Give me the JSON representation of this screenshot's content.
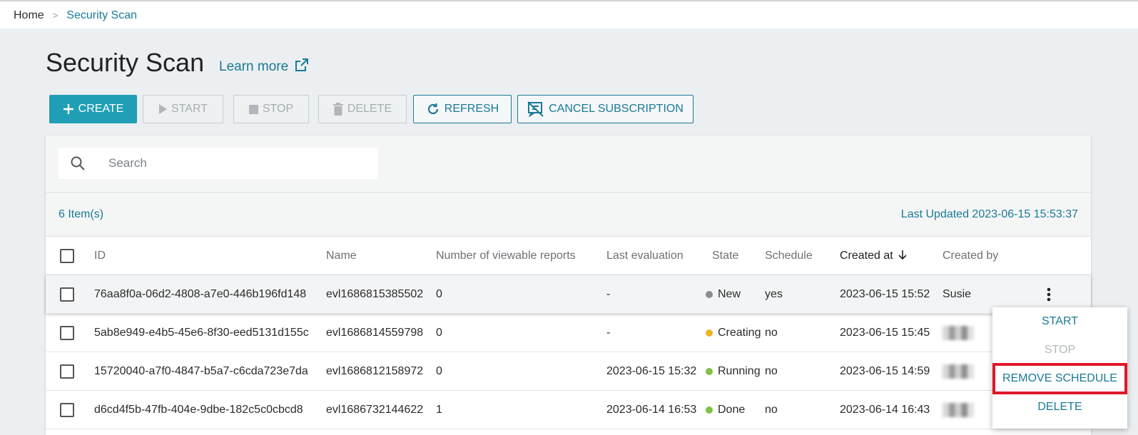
{
  "breadcrumb": {
    "home": "Home",
    "separator": ">",
    "current": "Security Scan"
  },
  "page": {
    "title": "Security Scan",
    "learn_more": "Learn more"
  },
  "toolbar": {
    "create": "CREATE",
    "start": "START",
    "stop": "STOP",
    "delete": "DELETE",
    "refresh": "REFRESH",
    "cancel_subscription": "CANCEL SUBSCRIPTION"
  },
  "search": {
    "placeholder": "Search"
  },
  "list": {
    "count": "6 Item(s)",
    "last_updated": "Last Updated 2023-06-15 15:53:37"
  },
  "table": {
    "columns": {
      "id": "ID",
      "name": "Name",
      "reports": "Number of viewable reports",
      "last_eval": "Last evaluation",
      "state": "State",
      "schedule": "Schedule",
      "created_at": "Created at",
      "created_by": "Created by"
    },
    "rows": [
      {
        "id": "76aa8f0a-06d2-4808-a7e0-446b196fd148",
        "name": "evl1686815385502",
        "reports": "0",
        "last_eval": "-",
        "state": "New",
        "state_color": "#8a8d90",
        "schedule": "yes",
        "created_at": "2023-06-15 15:52",
        "created_by": "Susie"
      },
      {
        "id": "5ab8e949-e4b5-45e6-8f30-eed5131d155c",
        "name": "evl1686814559798",
        "reports": "0",
        "last_eval": "-",
        "state": "Creating",
        "state_color": "#f0b323",
        "schedule": "no",
        "created_at": "2023-06-15 15:45",
        "created_by": ""
      },
      {
        "id": "15720040-a7f0-4847-b5a7-c6cda723e7da",
        "name": "evl1686812158972",
        "reports": "0",
        "last_eval": "2023-06-15 15:32",
        "state": "Running",
        "state_color": "#7dc242",
        "schedule": "no",
        "created_at": "2023-06-15 14:59",
        "created_by": ""
      },
      {
        "id": "d6cd4f5b-47fb-404e-9dbe-182c5c0cbcd8",
        "name": "evl1686732144622",
        "reports": "1",
        "last_eval": "2023-06-14 16:53",
        "state": "Done",
        "state_color": "#7dc242",
        "schedule": "no",
        "created_at": "2023-06-14 16:43",
        "created_by": ""
      }
    ]
  },
  "row_menu": {
    "start": "START",
    "stop": "STOP",
    "remove_schedule": "REMOVE SCHEDULE",
    "delete": "DELETE"
  },
  "colors": {
    "accent": "#1a7a96",
    "primary_button": "#1f9eb6",
    "highlight_box": "#e0172b"
  }
}
